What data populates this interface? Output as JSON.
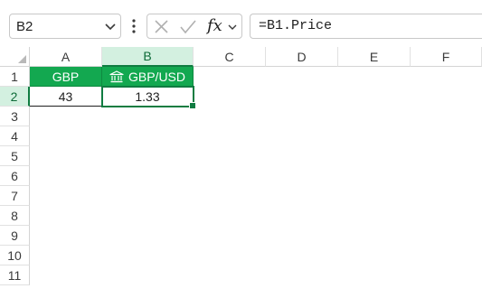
{
  "formula_bar": {
    "name_box": "B2",
    "formula": "=B1.Price",
    "fx_label": "fx",
    "icons": [
      "chevron-down-icon",
      "more-vertical-icon",
      "cancel-x-icon",
      "confirm-check-icon",
      "fx-icon",
      "chevron-down-icon"
    ]
  },
  "grid": {
    "columns": [
      "A",
      "B",
      "C",
      "D",
      "E",
      "F"
    ],
    "rows": [
      "1",
      "2",
      "3",
      "4",
      "5",
      "6",
      "7",
      "8",
      "9",
      "10",
      "11"
    ],
    "selected_column": "B",
    "selected_row": "2",
    "cells": {
      "A1": "GBP",
      "B1": "GBP/USD",
      "A2": "43",
      "B2": "1.33"
    },
    "header_fill": "#13a850",
    "header_text_color": "#ffffff",
    "selection_color": "#107c41",
    "B1_icon": "bank-icon"
  }
}
